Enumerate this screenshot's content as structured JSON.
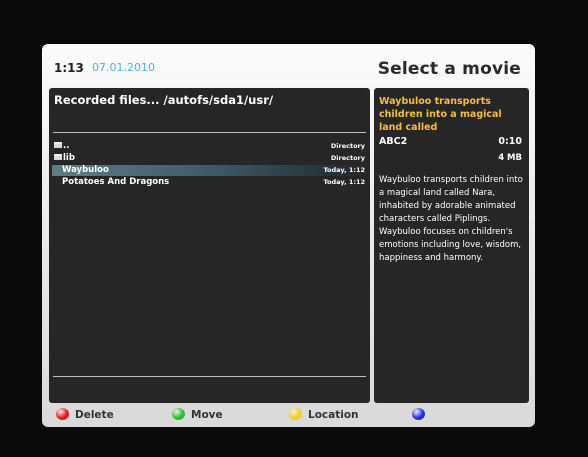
{
  "header": {
    "time": "1:13",
    "date": "07.01.2010",
    "title": "Select a movie"
  },
  "file_browser": {
    "path": "Recorded files... /autofs/sda1/usr/",
    "items": [
      {
        "name": "..",
        "info": "Directory",
        "type": "folder",
        "selected": false
      },
      {
        "name": "lib",
        "info": "Directory",
        "type": "folder",
        "selected": false
      },
      {
        "name": "Waybuloo",
        "info": "Today, 1:12",
        "type": "movie",
        "selected": true
      },
      {
        "name": "Potatoes And Dragons",
        "info": "Today, 1:12",
        "type": "movie",
        "selected": false
      }
    ]
  },
  "details": {
    "title": "Waybuloo transports children into a magical land called",
    "channel": "ABC2",
    "duration": "0:10",
    "size": "4 MB",
    "description": "Waybuloo transports children into a magical land called Nara, inhabited by adorable animated characters called Piplings. Waybuloo focuses on children's emotions including love, wisdom, happiness and harmony."
  },
  "footer": {
    "buttons": [
      {
        "label": "Delete",
        "color": "#e8161c",
        "icon": "red-button-icon"
      },
      {
        "label": "Move",
        "color": "#29c22c",
        "icon": "green-button-icon"
      },
      {
        "label": "Location",
        "color": "#f0d21c",
        "icon": "yellow-button-icon"
      },
      {
        "label": "",
        "color": "#1c2ee8",
        "icon": "blue-button-icon"
      }
    ]
  },
  "colors": {
    "accent_date": "#48b6e4",
    "accent_title": "#f3c038",
    "panel_bg": "#262626",
    "frame_bg": "#e8e8e8"
  }
}
